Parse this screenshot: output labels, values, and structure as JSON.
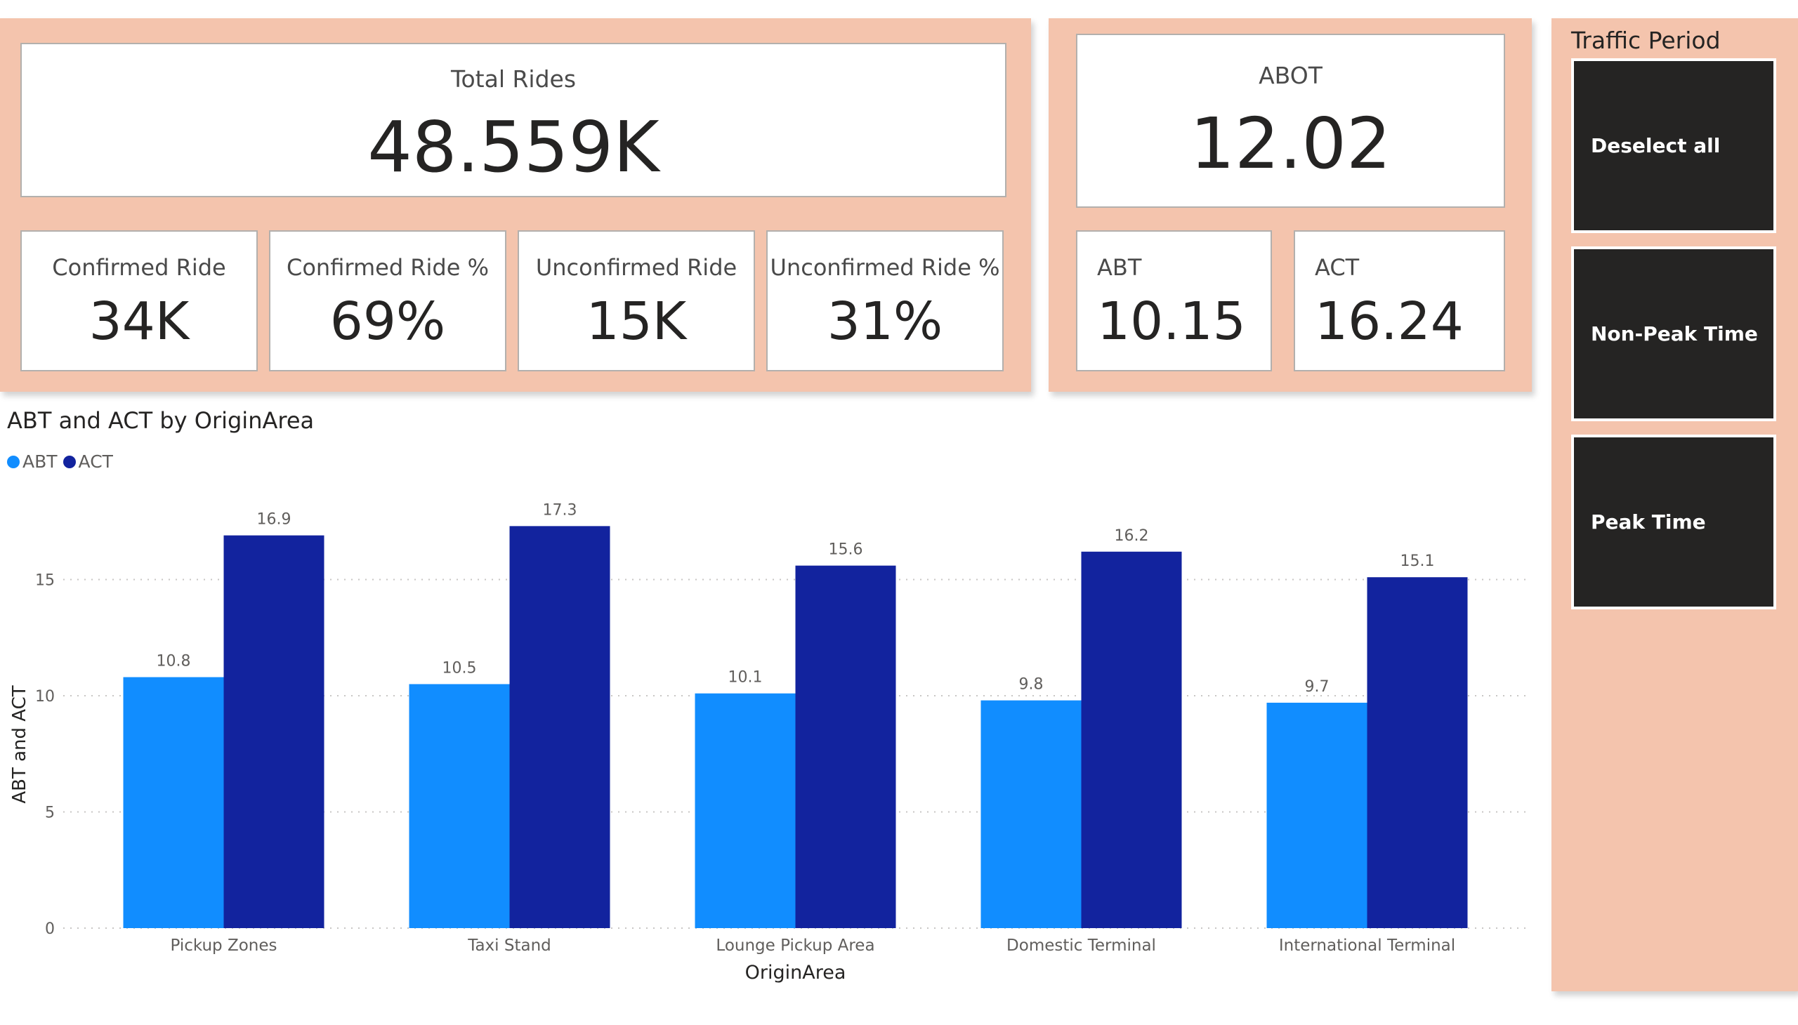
{
  "kpis": {
    "total_rides": {
      "label": "Total Rides",
      "value": "48.559K"
    },
    "confirmed_ride": {
      "label": "Confirmed Ride",
      "value": "34K"
    },
    "confirmed_ride_pct": {
      "label": "Confirmed Ride %",
      "value": "69%"
    },
    "unconfirmed_ride": {
      "label": "Unconfirmed Ride",
      "value": "15K"
    },
    "unconfirmed_ride_pct": {
      "label": "Unconfirmed Ride %",
      "value": "31%"
    },
    "abot": {
      "label": "ABOT",
      "value": "12.02"
    },
    "abt": {
      "label": "ABT",
      "value": "10.15"
    },
    "act": {
      "label": "ACT",
      "value": "16.24"
    }
  },
  "slicer": {
    "title": "Traffic Period",
    "buttons": [
      "Deselect all",
      "Non-Peak Time",
      "Peak Time"
    ]
  },
  "colors": {
    "panel": "#f4c4ad",
    "abt": "#118dff",
    "act": "#12239e",
    "slicer_button": "#252423"
  },
  "chart_data": {
    "type": "bar",
    "title": "ABT and ACT by OriginArea",
    "xlabel": "OriginArea",
    "ylabel": "ABT and ACT",
    "categories": [
      "Pickup Zones",
      "Taxi Stand",
      "Lounge Pickup Area",
      "Domestic Terminal",
      "International Terminal"
    ],
    "series": [
      {
        "name": "ABT",
        "values": [
          10.8,
          10.5,
          10.1,
          9.8,
          9.7
        ]
      },
      {
        "name": "ACT",
        "values": [
          16.9,
          17.3,
          15.6,
          16.2,
          15.1
        ]
      }
    ],
    "ylim": [
      0,
      17.3
    ],
    "yticks": [
      0,
      5,
      10,
      15
    ],
    "grid": true,
    "legend": "top-left"
  }
}
